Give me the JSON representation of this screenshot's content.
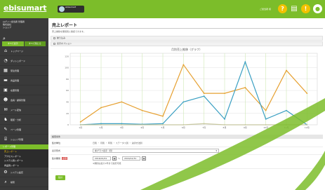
{
  "header": {
    "logo_main": "ebisumart",
    "site_name": "ebisumart",
    "user_text": "ご担当者 様",
    "icons": [
      "question-icon",
      "cart-icon",
      "notification-icon",
      "help-icon"
    ]
  },
  "sidebar": {
    "user_lines": [
      "ログイン担当者 管理者",
      "株式会社",
      "ショップ"
    ],
    "search_icon": "search-icon",
    "tabs": [
      "すべて表示",
      "すべて閉じる"
    ],
    "items": [
      {
        "icon": "home-icon",
        "label": "トップページ"
      },
      {
        "icon": "chart-icon",
        "label": "ダッシュボード"
      },
      {
        "icon": "order-icon",
        "label": "受注管理"
      },
      {
        "icon": "product-icon",
        "label": "商品管理"
      },
      {
        "icon": "stock-icon",
        "label": "在庫管理"
      },
      {
        "icon": "member-icon",
        "label": "会員・顧客管理"
      },
      {
        "icon": "mail-icon",
        "label": "メール配信"
      },
      {
        "icon": "campaign-icon",
        "label": "販促・分析"
      },
      {
        "icon": "content-icon",
        "label": "ページ管理"
      },
      {
        "icon": "shop-icon",
        "label": "ショップ管理"
      }
    ],
    "sub_header": "レポート管理",
    "sub_items": [
      "売上レポート",
      "アクセスレポート",
      "システム別レポート",
      "商品別レポート"
    ],
    "bottom_items": [
      {
        "icon": "settings-icon",
        "label": "システム設定"
      },
      {
        "icon": "search-icon",
        "label": "検索"
      }
    ]
  },
  "main": {
    "title": "売上レポート",
    "description": "売上推移を期間別に確認できます。",
    "checkbox1": "絞り込み",
    "checkbox2": "表示オプション"
  },
  "chart_data": {
    "type": "line",
    "title": "月別売上推移（グラフ）",
    "categories": [
      "1月",
      "2月",
      "3月",
      "4月",
      "5月",
      "6月",
      "7月",
      "8月",
      "9月",
      "10月",
      "11月",
      "12月"
    ],
    "series": [
      {
        "name": "",
        "color": "#e6a030",
        "values": [
          5,
          30,
          40,
          25,
          15,
          105,
          55,
          55,
          65,
          25,
          95,
          55
        ]
      },
      {
        "name": "",
        "color": "#3a9fc2",
        "values": [
          0,
          2,
          2,
          1,
          2,
          40,
          50,
          10,
          110,
          10,
          25,
          0
        ]
      },
      {
        "name": "",
        "color": "#c8c8a0",
        "values": [
          0,
          0,
          0,
          0,
          0,
          0,
          2,
          0,
          0,
          0,
          0,
          0
        ]
      }
    ],
    "y_ticks": [
      "0",
      "20",
      "40",
      "60",
      "80",
      "100",
      "120"
    ],
    "ylim": [
      0,
      125
    ],
    "grid": true
  },
  "filter": {
    "header": "検索条件",
    "rows": [
      {
        "label": "集計単位",
        "value": "日別 ・ 月別 ・ 年別 ・ ステータス別 ・ 決済方法別"
      },
      {
        "label": "表示形式",
        "value": "棒グラフ表示（月）"
      },
      {
        "label": "集計期間",
        "required": "必須",
        "from": "2016/01/01",
        "to": "2016/12/31",
        "note": "※期間は最大1年まで指定可能"
      }
    ],
    "submit": "集計"
  }
}
